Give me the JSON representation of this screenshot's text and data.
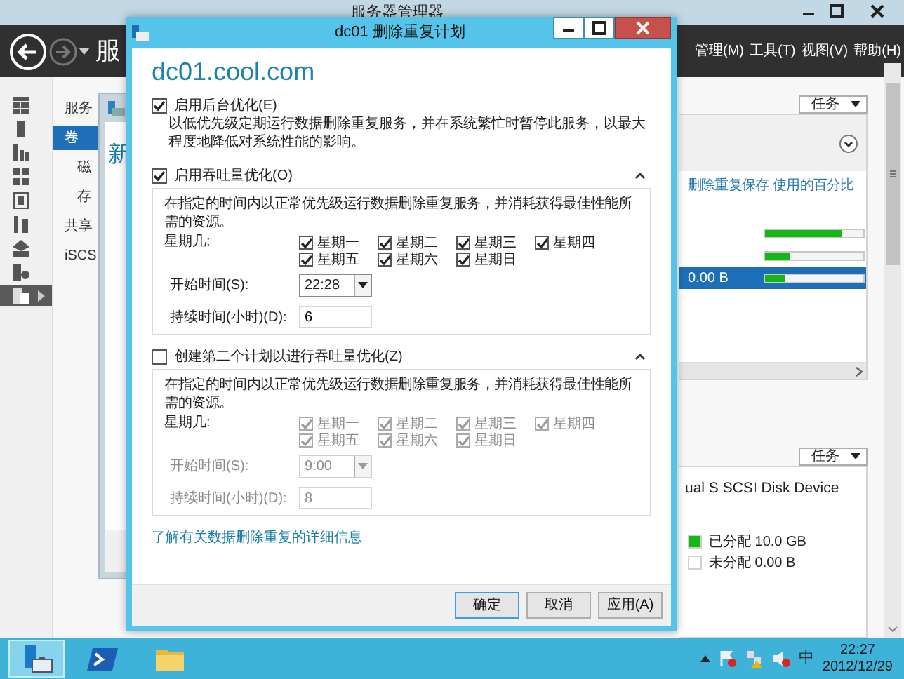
{
  "server_manager": {
    "title": "服务器管理器",
    "heading": "服",
    "menu": [
      "管理(M)",
      "工具(T)",
      "视图(V)",
      "帮助(H)"
    ],
    "icon_rail": [
      {
        "kind": "grid",
        "selected": false
      },
      {
        "kind": "server",
        "selected": false
      },
      {
        "kind": "servers",
        "selected": false
      },
      {
        "kind": "network",
        "selected": false
      },
      {
        "kind": "cabinet",
        "selected": false
      },
      {
        "kind": "tools",
        "selected": false
      },
      {
        "kind": "stack",
        "selected": false
      },
      {
        "kind": "disk",
        "selected": false
      },
      {
        "kind": "files",
        "selected": true
      }
    ],
    "nav": [
      {
        "label": "服务",
        "selected": false
      },
      {
        "label": "卷",
        "selected": true,
        "children": [
          {
            "label": "磁",
            "selected": false
          },
          {
            "label": "存",
            "selected": false
          }
        ]
      },
      {
        "label": "共享",
        "selected": false
      },
      {
        "label": "iSCS",
        "selected": false
      }
    ],
    "volumes": {
      "tasks": "任务",
      "columns": [
        "删除重复保存",
        "使用的百分比"
      ],
      "rows": [
        {
          "level": 0.78,
          "selected": false
        },
        {
          "level": 0.25,
          "selected": false
        },
        {
          "savings": "0.00 B",
          "level": 0.2,
          "selected": true
        }
      ]
    },
    "disk": {
      "tasks": "任务",
      "name": "ual S SCSI Disk Device",
      "legend": [
        {
          "label": "已分配 10.0 GB",
          "color": "#14b814"
        },
        {
          "label": "未分配 0.00 B",
          "color": "#ffffff"
        }
      ]
    }
  },
  "behind_dialog": {
    "heading": "新"
  },
  "dialog": {
    "title": "dc01 删除重复计划",
    "host": "dc01.cool.com",
    "background": {
      "label": "启用后台优化(E)",
      "checked": true,
      "description": "以低优先级定期运行数据删除重复服务，并在系统繁忙时暂停此服务，以最大程度地降低对系统性能的影响。"
    },
    "schedules": [
      {
        "label": "启用吞吐量优化(O)",
        "checked": true,
        "expanded": true,
        "description": "在指定的时间内以正常优先级运行数据删除重复服务，并消耗获得最佳性能所需的资源。",
        "days_label": "星期几:",
        "days": [
          {
            "label": "星期一",
            "checked": true
          },
          {
            "label": "星期二",
            "checked": true
          },
          {
            "label": "星期三",
            "checked": true
          },
          {
            "label": "星期四",
            "checked": true
          },
          {
            "label": "星期五",
            "checked": true
          },
          {
            "label": "星期六",
            "checked": true
          },
          {
            "label": "星期日",
            "checked": true
          }
        ],
        "start_label": "开始时间(S):",
        "start_time": "22:28",
        "duration_label": "持续时间(小时)(D):",
        "duration": "6"
      },
      {
        "label": "创建第二个计划以进行吞吐量优化(Z)",
        "checked": false,
        "expanded": true,
        "description": "在指定的时间内以正常优先级运行数据删除重复服务，并消耗获得最佳性能所需的资源。",
        "days_label": "星期几:",
        "days": [
          {
            "label": "星期一",
            "checked": true
          },
          {
            "label": "星期二",
            "checked": true
          },
          {
            "label": "星期三",
            "checked": true
          },
          {
            "label": "星期四",
            "checked": true
          },
          {
            "label": "星期五",
            "checked": true
          },
          {
            "label": "星期六",
            "checked": true
          },
          {
            "label": "星期日",
            "checked": true
          }
        ],
        "start_label": "开始时间(S):",
        "start_time": "9:00",
        "duration_label": "持续时间(小时)(D):",
        "duration": "8"
      }
    ],
    "link": "了解有关数据删除重复的详细信息",
    "buttons": [
      {
        "label": "确定",
        "default": true
      },
      {
        "label": "取消",
        "default": false
      },
      {
        "label": "应用(A)",
        "default": false
      }
    ]
  },
  "taskbar": {
    "apps": [
      {
        "kind": "server-manager",
        "selected": true
      },
      {
        "kind": "powershell",
        "selected": false
      },
      {
        "kind": "folder",
        "selected": false
      }
    ],
    "ime": "中",
    "time": "22:27",
    "date": "2012/12/29"
  }
}
